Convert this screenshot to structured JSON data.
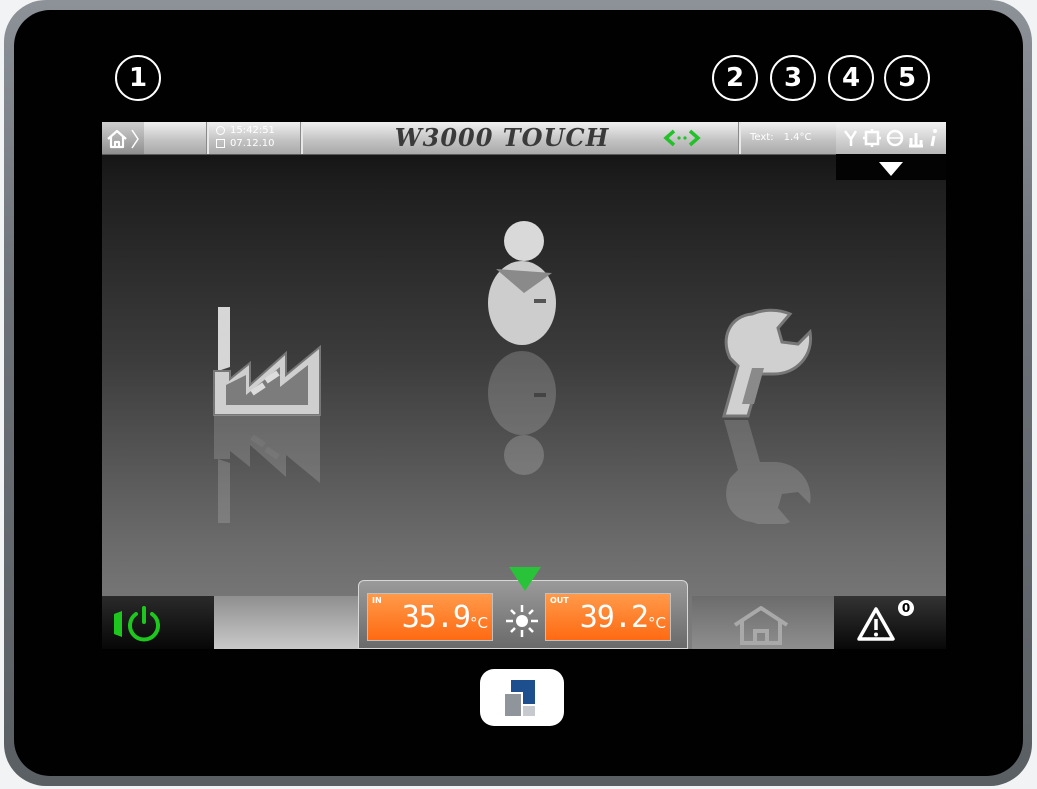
{
  "callouts": [
    "1",
    "2",
    "3",
    "4",
    "5"
  ],
  "topbar": {
    "time": "15:42:51",
    "date": "07.12.10",
    "title": "W3000 TOUCH",
    "ext_temp_label": "Text:",
    "ext_temp_value": "1.4°C",
    "icons": [
      "home-icon",
      "clock-icon",
      "calendar-icon",
      "network-status-icon",
      "tool-icon",
      "settings-icon",
      "globe-icon",
      "chart-icon",
      "info-icon"
    ],
    "network_color": "#22c12a"
  },
  "main_menu": {
    "items": [
      "factory-icon",
      "user-icon",
      "wrench-icon"
    ]
  },
  "bottombar": {
    "in_label": "IN",
    "in_value": "35.9",
    "in_unit": "°C",
    "out_label": "OUT",
    "out_value": "39.2",
    "out_unit": "°C",
    "alarm_count": "0",
    "power_color": "#1ec71e",
    "temp_box_color": "#ff7a1f",
    "mode_icon": "sun-icon"
  }
}
